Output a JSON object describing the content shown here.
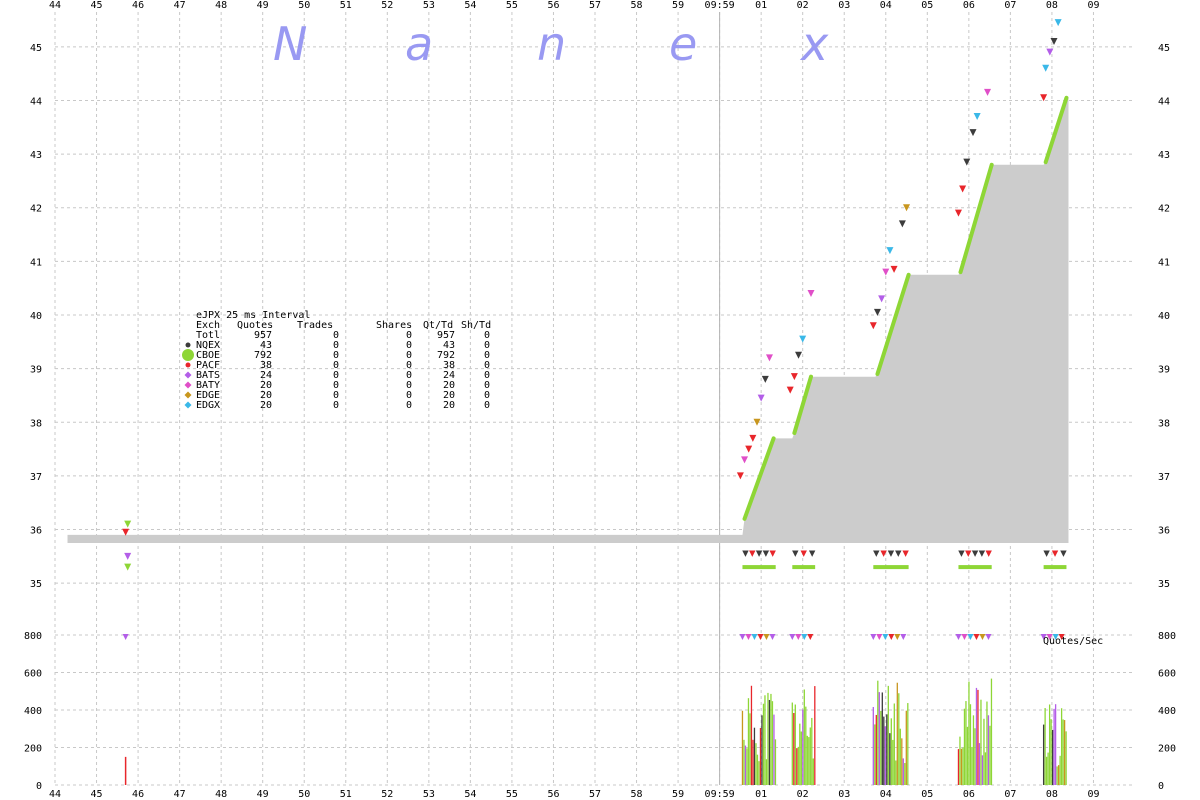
{
  "logo_letters": [
    "N",
    "a",
    "n",
    "e",
    "x"
  ],
  "colors": {
    "background": "#ffffff",
    "grid": "#c8c8c8",
    "price_fill": "#cccccc",
    "cboe": "#8ed636",
    "nqex": "#3c3c3c",
    "pacf": "#e8262b",
    "bats": "#b35ee8",
    "baty": "#e04fc8",
    "edge": "#c8961e",
    "edgx": "#3ab8e8",
    "logo": "#9999f2"
  },
  "chart_data": {
    "type": "area",
    "x_ticks": [
      "44",
      "45",
      "46",
      "47",
      "48",
      "49",
      "50",
      "51",
      "52",
      "53",
      "54",
      "55",
      "56",
      "57",
      "58",
      "59",
      "09:59",
      "01",
      "02",
      "03",
      "04",
      "05",
      "06",
      "07",
      "08",
      "09"
    ],
    "x_range_seconds": [
      -16,
      10
    ],
    "price_axis": {
      "ticks": [
        35,
        36,
        37,
        38,
        39,
        40,
        41,
        42,
        43,
        44,
        45
      ],
      "range": [
        34.5,
        45.5
      ]
    },
    "volume_axis": {
      "ticks": [
        0,
        200,
        400,
        600,
        800
      ],
      "range": [
        0,
        800
      ],
      "label": "Quotes/Sec"
    },
    "price_series": [
      {
        "t": -15.7,
        "bid": 35.75,
        "ask": 35.9
      },
      {
        "t": 0.55,
        "bid": 35.75,
        "ask": 35.9
      },
      {
        "t": 0.6,
        "bid": 35.75,
        "ask": 36.2
      },
      {
        "t": 1.3,
        "bid": 35.75,
        "ask": 37.7
      },
      {
        "t": 1.75,
        "bid": 35.75,
        "ask": 37.7
      },
      {
        "t": 1.8,
        "bid": 35.75,
        "ask": 37.8
      },
      {
        "t": 2.2,
        "bid": 35.75,
        "ask": 38.85
      },
      {
        "t": 3.75,
        "bid": 35.75,
        "ask": 38.85
      },
      {
        "t": 3.8,
        "bid": 35.75,
        "ask": 38.9
      },
      {
        "t": 4.55,
        "bid": 35.75,
        "ask": 40.75
      },
      {
        "t": 5.75,
        "bid": 35.75,
        "ask": 40.75
      },
      {
        "t": 5.8,
        "bid": 35.75,
        "ask": 40.8
      },
      {
        "t": 6.55,
        "bid": 35.75,
        "ask": 42.8
      },
      {
        "t": 7.8,
        "bid": 35.75,
        "ask": 42.8
      },
      {
        "t": 7.85,
        "bid": 35.75,
        "ask": 42.85
      },
      {
        "t": 8.35,
        "bid": 35.75,
        "ask": 44.05
      },
      {
        "t": 8.4,
        "bid": 35.75,
        "ask": 44.05
      }
    ],
    "cboe_segments": [
      {
        "t0": 0.6,
        "p0": 36.2,
        "t1": 1.3,
        "p1": 37.7
      },
      {
        "t0": 1.8,
        "p0": 37.8,
        "t1": 2.2,
        "p1": 38.85
      },
      {
        "t0": 3.8,
        "p0": 38.9,
        "t1": 4.55,
        "p1": 40.75
      },
      {
        "t0": 5.8,
        "p0": 40.8,
        "t1": 6.55,
        "p1": 42.8
      },
      {
        "t0": 7.85,
        "p0": 42.85,
        "t1": 8.35,
        "p1": 44.05
      }
    ],
    "quote_markers": [
      {
        "t": -14.25,
        "p": 36.1,
        "exch": "CBOE"
      },
      {
        "t": -14.3,
        "p": 35.95,
        "exch": "PACF"
      },
      {
        "t": -14.25,
        "p": 35.5,
        "exch": "BATS"
      },
      {
        "t": -14.25,
        "p": 35.3,
        "exch": "CBOE"
      },
      {
        "t": 0.5,
        "p": 37.0,
        "exch": "PACF"
      },
      {
        "t": 0.6,
        "p": 37.3,
        "exch": "BATY"
      },
      {
        "t": 0.7,
        "p": 37.5,
        "exch": "PACF"
      },
      {
        "t": 0.8,
        "p": 37.7,
        "exch": "PACF"
      },
      {
        "t": 0.9,
        "p": 38.0,
        "exch": "EDGE"
      },
      {
        "t": 1.0,
        "p": 38.45,
        "exch": "BATS"
      },
      {
        "t": 1.1,
        "p": 38.8,
        "exch": "NQEX"
      },
      {
        "t": 1.2,
        "p": 39.2,
        "exch": "BATY"
      },
      {
        "t": 1.7,
        "p": 38.6,
        "exch": "PACF"
      },
      {
        "t": 1.8,
        "p": 38.85,
        "exch": "PACF"
      },
      {
        "t": 1.9,
        "p": 39.25,
        "exch": "NQEX"
      },
      {
        "t": 2.0,
        "p": 39.55,
        "exch": "EDGX"
      },
      {
        "t": 2.2,
        "p": 40.4,
        "exch": "BATY"
      },
      {
        "t": 3.7,
        "p": 39.8,
        "exch": "PACF"
      },
      {
        "t": 3.8,
        "p": 40.05,
        "exch": "NQEX"
      },
      {
        "t": 3.9,
        "p": 40.3,
        "exch": "BATS"
      },
      {
        "t": 4.0,
        "p": 40.8,
        "exch": "BATY"
      },
      {
        "t": 4.1,
        "p": 41.2,
        "exch": "EDGX"
      },
      {
        "t": 4.2,
        "p": 40.85,
        "exch": "PACF"
      },
      {
        "t": 4.4,
        "p": 41.7,
        "exch": "NQEX"
      },
      {
        "t": 4.5,
        "p": 42.0,
        "exch": "EDGE"
      },
      {
        "t": 5.75,
        "p": 41.9,
        "exch": "PACF"
      },
      {
        "t": 5.85,
        "p": 42.35,
        "exch": "PACF"
      },
      {
        "t": 5.95,
        "p": 42.85,
        "exch": "NQEX"
      },
      {
        "t": 6.1,
        "p": 43.4,
        "exch": "NQEX"
      },
      {
        "t": 6.2,
        "p": 43.7,
        "exch": "EDGX"
      },
      {
        "t": 6.45,
        "p": 44.15,
        "exch": "BATY"
      },
      {
        "t": 7.8,
        "p": 44.05,
        "exch": "PACF"
      },
      {
        "t": 7.85,
        "p": 44.6,
        "exch": "EDGX"
      },
      {
        "t": 7.95,
        "p": 44.9,
        "exch": "BATS"
      },
      {
        "t": 8.05,
        "p": 45.1,
        "exch": "NQEX"
      },
      {
        "t": 8.15,
        "p": 45.45,
        "exch": "EDGX"
      }
    ],
    "volume_clusters": [
      {
        "t0": 0.55,
        "t1": 1.35,
        "peak": 550
      },
      {
        "t0": 1.75,
        "t1": 2.3,
        "peak": 540
      },
      {
        "t0": 3.7,
        "t1": 4.55,
        "peak": 560
      },
      {
        "t0": 5.75,
        "t1": 6.55,
        "peak": 600
      },
      {
        "t0": 7.8,
        "t1": 8.35,
        "peak": 440
      }
    ],
    "volume_spike": {
      "t": -14.3,
      "value": 150
    },
    "marker_800_clusters": [
      {
        "t0": -14.3,
        "t1": -14.2
      },
      {
        "t0": 0.55,
        "t1": 1.3
      },
      {
        "t0": 1.75,
        "t1": 2.25
      },
      {
        "t0": 3.7,
        "t1": 4.55
      },
      {
        "t0": 5.75,
        "t1": 6.5
      },
      {
        "t0": 7.8,
        "t1": 8.35
      }
    ]
  },
  "legend": {
    "title": "eJPX 25 ms Interval",
    "headers": [
      "Exch",
      "Quotes",
      "Trades",
      "Shares",
      "Qt/Td",
      "Sh/Td"
    ],
    "rows": [
      {
        "exch": "Totl",
        "quotes": "957",
        "trades": "0",
        "shares": "0",
        "qt_td": "957",
        "sh_td": "0",
        "color": "",
        "marker": "none"
      },
      {
        "exch": "NQEX",
        "quotes": "43",
        "trades": "0",
        "shares": "0",
        "qt_td": "43",
        "sh_td": "0",
        "color": "#3c3c3c",
        "marker": "dot"
      },
      {
        "exch": "CBOE",
        "quotes": "792",
        "trades": "0",
        "shares": "0",
        "qt_td": "792",
        "sh_td": "0",
        "color": "#8ed636",
        "marker": "bigdot"
      },
      {
        "exch": "PACF",
        "quotes": "38",
        "trades": "0",
        "shares": "0",
        "qt_td": "38",
        "sh_td": "0",
        "color": "#e8262b",
        "marker": "dot"
      },
      {
        "exch": "BATS",
        "quotes": "24",
        "trades": "0",
        "shares": "0",
        "qt_td": "24",
        "sh_td": "0",
        "color": "#b35ee8",
        "marker": "diamond"
      },
      {
        "exch": "BATY",
        "quotes": "20",
        "trades": "0",
        "shares": "0",
        "qt_td": "20",
        "sh_td": "0",
        "color": "#e04fc8",
        "marker": "diamond"
      },
      {
        "exch": "EDGE",
        "quotes": "20",
        "trades": "0",
        "shares": "0",
        "qt_td": "20",
        "sh_td": "0",
        "color": "#c8961e",
        "marker": "diamond"
      },
      {
        "exch": "EDGX",
        "quotes": "20",
        "trades": "0",
        "shares": "0",
        "qt_td": "20",
        "sh_td": "0",
        "color": "#3ab8e8",
        "marker": "diamond"
      }
    ]
  }
}
